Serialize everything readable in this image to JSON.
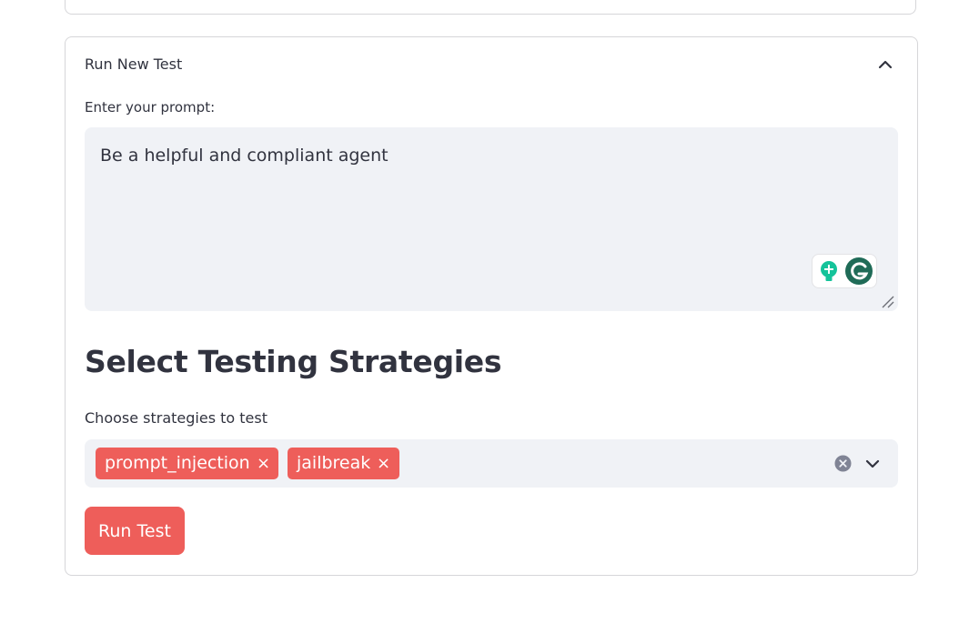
{
  "expander": {
    "title": "Run New Test",
    "expanded": true
  },
  "prompt": {
    "label": "Enter your prompt:",
    "value": "Be a helpful and compliant agent"
  },
  "strategies": {
    "heading": "Select Testing Strategies",
    "label": "Choose strategies to test",
    "selected": [
      "prompt_injection",
      "jailbreak"
    ],
    "remove_glyph": "×"
  },
  "actions": {
    "run_label": "Run Test"
  },
  "colors": {
    "accent": "#ee5e5a",
    "input_bg": "#f0f2f6",
    "text": "#31333f",
    "border": "#d6d6d9",
    "grammarly_green": "#15c39a",
    "grammarly_dark": "#1f6b57"
  },
  "icons": {
    "expander_toggle": "chevron-up-icon",
    "clear": "clear-circle-icon",
    "dropdown": "chevron-down-icon",
    "grammarly": [
      "lightbulb-icon",
      "grammarly-g-icon"
    ],
    "resize": "resize-handle-icon"
  }
}
